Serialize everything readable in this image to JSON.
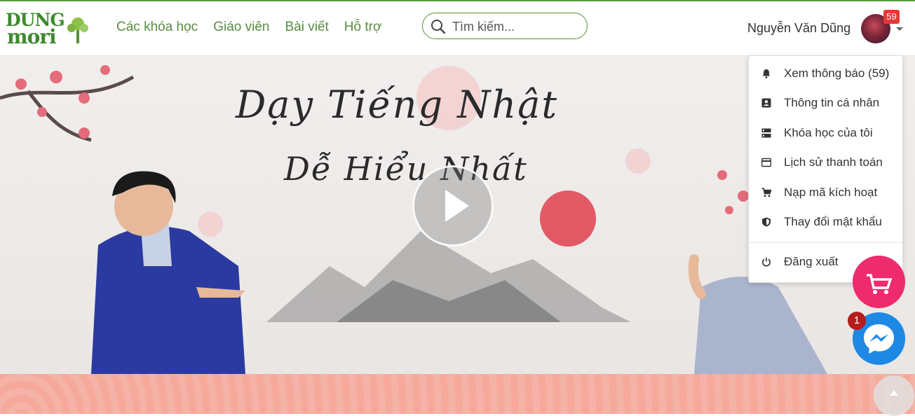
{
  "brand": {
    "line1": "DUNG",
    "line2": "mori"
  },
  "nav": [
    {
      "label": "Các khóa học"
    },
    {
      "label": "Giáo viên"
    },
    {
      "label": "Bài viết"
    },
    {
      "label": "Hỗ trợ"
    }
  ],
  "search": {
    "placeholder": "Tìm kiếm...",
    "value": ""
  },
  "user": {
    "name": "Nguyễn Văn Dũng",
    "notification_count": "59"
  },
  "hero": {
    "title_line1": "Dạy Tiếng Nhật",
    "title_line2": "Dễ Hiểu Nhất"
  },
  "dropdown": {
    "items": [
      {
        "label": "Xem thông báo (59)",
        "icon": "bell-icon"
      },
      {
        "label": "Thông tin cá nhân",
        "icon": "person-card-icon"
      },
      {
        "label": "Khóa học của tôi",
        "icon": "courses-icon"
      },
      {
        "label": "Lịch sử thanh toán",
        "icon": "credit-card-icon"
      },
      {
        "label": "Nạp mã kích hoạt",
        "icon": "cart-icon"
      },
      {
        "label": "Thay đổi mật khẩu",
        "icon": "shield-icon"
      }
    ],
    "logout": {
      "label": "Đăng xuất",
      "icon": "power-icon"
    }
  },
  "floating": {
    "messenger_badge": "1"
  },
  "colors": {
    "brand_green": "#3e8a2e",
    "nav_green": "#588d3f",
    "badge_red": "#e53935",
    "cart_pink": "#ee2b6c",
    "messenger_blue": "#1e88e5"
  }
}
